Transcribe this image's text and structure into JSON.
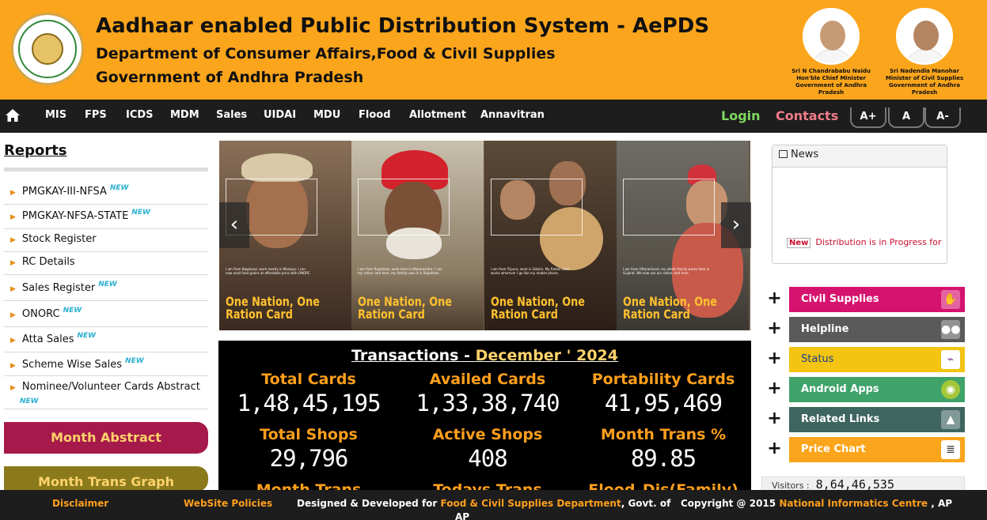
{
  "header": {
    "title": "Aadhaar enabled Public Distribution System - AePDS",
    "department": "Department of Consumer Affairs,Food & Civil Supplies",
    "government": "Government of Andhra Pradesh",
    "people": [
      {
        "name": "Sri N Chandrababu Naidu",
        "role": "Hon'ble Chief Minister",
        "org": "Government of Andhra Pradesh"
      },
      {
        "name": "Sri Nadendla Manohar",
        "role": "Minister of Civil Supplies",
        "org": "Government of Andhra Pradesh"
      }
    ]
  },
  "nav": {
    "items": [
      "MIS",
      "FPS",
      "ICDS",
      "MDM",
      "Sales",
      "UIDAI",
      "MDU",
      "Flood",
      "Allotment",
      "Annavitran"
    ],
    "login": "Login",
    "contacts": "Contacts",
    "font_buttons": [
      "A+",
      "A",
      "A-"
    ]
  },
  "sidebar": {
    "title": "Reports",
    "new_badge": "NEW",
    "items": [
      {
        "label": "PMGKAY-III-NFSA",
        "new": true
      },
      {
        "label": "PMGKAY-NFSA-STATE",
        "new": true
      },
      {
        "label": "Stock Register",
        "new": false
      },
      {
        "label": "RC Details",
        "new": false
      },
      {
        "label": "Sales Register",
        "new": true
      },
      {
        "label": "ONORC",
        "new": true
      },
      {
        "label": "Atta Sales",
        "new": true
      },
      {
        "label": "Scheme Wise Sales",
        "new": true
      },
      {
        "label": "Nominee/Volunteer Cards Abstract",
        "new": true
      }
    ],
    "month_abstract": "Month Abstract",
    "month_trans_graph": "Month Trans Graph"
  },
  "slider": {
    "slogan": "One Nation, One Ration Card",
    "panels": [
      {
        "caption": "I am from Nagaland, work mostly in Manipur. I can now avail food grains at affordable price with ONORC"
      },
      {
        "caption": "I am from Rajasthan, work here in Maharashtra. I can my ration card here, my family uses it in Rajasthan"
      },
      {
        "caption": "I am from Tripura, work in Sikkim. My Ration card works wherever I go like my mobile phone."
      },
      {
        "caption": "I am from Uttarakhand, my whole family works here in Gujarat. We now use our ration card here"
      }
    ],
    "prev": "‹",
    "next": "›"
  },
  "transactions": {
    "title_prefix": "Transactions - ",
    "month": "December ' 2024",
    "stats": [
      {
        "label": "Total Cards",
        "value": "1,48,45,195"
      },
      {
        "label": "Availed Cards",
        "value": "1,33,38,740"
      },
      {
        "label": "Portability Cards",
        "value": "41,95,469"
      },
      {
        "label": "Total Shops",
        "value": "29,796"
      },
      {
        "label": "Active Shops",
        "value": "408"
      },
      {
        "label": "Month Trans %",
        "value": "89.85"
      },
      {
        "label": "Month Trans",
        "value": ""
      },
      {
        "label": "Todays Trans",
        "value": ""
      },
      {
        "label": "Flood_Dis(Family)",
        "value": ""
      }
    ]
  },
  "news": {
    "title": "News",
    "badge": "New",
    "text": "Distribution is in Progress for"
  },
  "quick_links": [
    {
      "label": "Civil Supplies",
      "color": "#d6126f",
      "icon": "handshake-icon"
    },
    {
      "label": "Helpline",
      "color": "#5a5a5a",
      "icon": "people-icon"
    },
    {
      "label": "Status",
      "color": "#f3c412",
      "icon": "chart-icon"
    },
    {
      "label": "Android Apps",
      "color": "#3fa36a",
      "icon": "android-icon"
    },
    {
      "label": "Related Links",
      "color": "#3f6560",
      "icon": "graduation-cap-icon"
    },
    {
      "label": "Price Chart",
      "color": "#fba51c",
      "icon": "database-icon"
    }
  ],
  "visitors": {
    "label": "Visitors :",
    "count": "8,64,46,535"
  },
  "footer": {
    "disclaimer": "Disclaimer",
    "policies": "WebSite Policies",
    "designed_prefix": "Designed & Developed for",
    "designed_org": "Food & Civil Supplies Department",
    "designed_suffix": ",   Govt. of",
    "designed_state": "AP",
    "copyright_prefix": "Copyright @ 2015",
    "copyright_org": "National Informatics Centre",
    "copyright_suffix": ", AP"
  }
}
